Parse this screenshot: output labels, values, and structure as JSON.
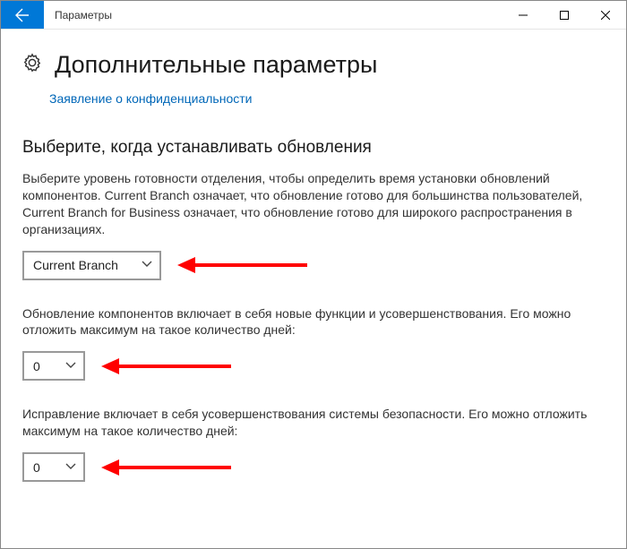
{
  "titlebar": {
    "app_title": "Параметры"
  },
  "header": {
    "page_title": "Дополнительные параметры",
    "privacy_link": "Заявление о конфиденциальности"
  },
  "section": {
    "heading": "Выберите, когда устанавливать обновления",
    "branch_desc": "Выберите уровень готовности отделения, чтобы определить время установки обновлений компонентов. Current Branch означает, что обновление готово для большинства пользователей, Current Branch for Business означает, что обновление готово для широкого распространения в организациях.",
    "branch_value": "Current Branch",
    "feature_desc": "Обновление компонентов включает в себя новые функции и усовершенствования. Его можно отложить максимум на такое количество дней:",
    "feature_defer_value": "0",
    "quality_desc": "Исправление включает в себя усовершенствования системы безопасности. Его можно отложить максимум на такое количество дней:",
    "quality_defer_value": "0"
  }
}
